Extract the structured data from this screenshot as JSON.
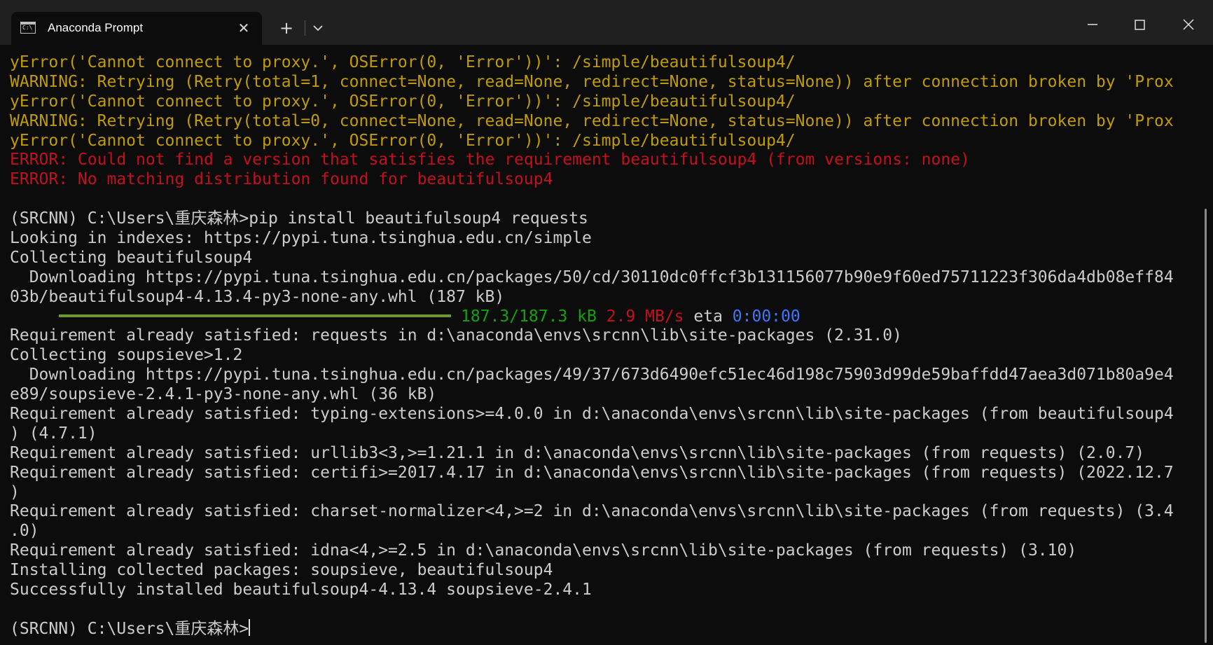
{
  "window": {
    "tab_title": "Anaconda Prompt",
    "tab_icon_text": "C:\\",
    "close_glyph": "✕",
    "new_tab_glyph": "+"
  },
  "icons": {
    "tab_icon": "terminal-icon",
    "tab_close": "close-icon",
    "new_tab": "plus-icon",
    "dropdown": "chevron-down-icon",
    "minimize": "minimize-icon",
    "maximize": "maximize-icon",
    "close": "close-icon"
  },
  "colors": {
    "background": "#0c0c0c",
    "titlebar": "#202020",
    "text": "#cccccc",
    "warning": "#c19c00",
    "error": "#c50f1f",
    "green": "#13a10e",
    "blue": "#3b78ff",
    "progress_bar": "#6b9a2a"
  },
  "terminal": {
    "lines": [
      "yError('Cannot connect to proxy.', OSError(0, 'Error'))': /simple/beautifulsoup4/",
      "WARNING: Retrying (Retry(total=1, connect=None, read=None, redirect=None, status=None)) after connection broken by 'Prox",
      "yError('Cannot connect to proxy.', OSError(0, 'Error'))': /simple/beautifulsoup4/",
      "WARNING: Retrying (Retry(total=0, connect=None, read=None, redirect=None, status=None)) after connection broken by 'Prox",
      "yError('Cannot connect to proxy.', OSError(0, 'Error'))': /simple/beautifulsoup4/",
      "ERROR: Could not find a version that satisfies the requirement beautifulsoup4 (from versions: none)",
      "ERROR: No matching distribution found for beautifulsoup4",
      "",
      "(SRCNN) C:\\Users\\重庆森林>pip install beautifulsoup4 requests",
      "Looking in indexes: https://pypi.tuna.tsinghua.edu.cn/simple",
      "Collecting beautifulsoup4",
      "  Downloading https://pypi.tuna.tsinghua.edu.cn/packages/50/cd/30110dc0ffcf3b131156077b90e9f60ed75711223f306da4db08eff84",
      "03b/beautifulsoup4-4.13.4-py3-none-any.whl (187 kB)",
      "",
      "Requirement already satisfied: requests in d:\\anaconda\\envs\\srcnn\\lib\\site-packages (2.31.0)",
      "Collecting soupsieve>1.2",
      "  Downloading https://pypi.tuna.tsinghua.edu.cn/packages/49/37/673d6490efc51ec46d198c75903d99de59baffdd47aea3d071b80a9e4",
      "e89/soupsieve-2.4.1-py3-none-any.whl (36 kB)",
      "Requirement already satisfied: typing-extensions>=4.0.0 in d:\\anaconda\\envs\\srcnn\\lib\\site-packages (from beautifulsoup4",
      ") (4.7.1)",
      "Requirement already satisfied: urllib3<3,>=1.21.1 in d:\\anaconda\\envs\\srcnn\\lib\\site-packages (from requests) (2.0.7)",
      "Requirement already satisfied: certifi>=2017.4.17 in d:\\anaconda\\envs\\srcnn\\lib\\site-packages (from requests) (2022.12.7",
      ")",
      "Requirement already satisfied: charset-normalizer<4,>=2 in d:\\anaconda\\envs\\srcnn\\lib\\site-packages (from requests) (3.4",
      ".0)",
      "Requirement already satisfied: idna<4,>=2.5 in d:\\anaconda\\envs\\srcnn\\lib\\site-packages (from requests) (3.10)",
      "Installing collected packages: soupsieve, beautifulsoup4",
      "Successfully installed beautifulsoup4-4.13.4 soupsieve-2.4.1",
      "",
      "(SRCNN) C:\\Users\\重庆森林>"
    ],
    "progress": {
      "fraction": 1.0,
      "size": "187.3/187.3 kB",
      "speed": "2.9 MB/s",
      "eta_label": "eta",
      "eta": "0:00:00"
    }
  }
}
